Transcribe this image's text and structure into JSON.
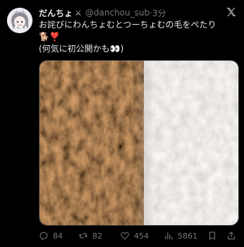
{
  "tweet": {
    "display_name": "だんちょ",
    "name_emoji": "⚔",
    "handle": "@danchou_sub",
    "separator": "·",
    "time": "3分",
    "text_line1": "お詫びにわんちょむとつーちょむの毛をぺたり",
    "text_line2": "🐕❣️",
    "text_line3": "(何気に初公開かも👀)"
  },
  "actions": {
    "replies": "84",
    "retweets": "82",
    "likes": "454",
    "views": "5861"
  },
  "icons": [
    "avatar",
    "crossed-swords-icon",
    "x-logo-icon",
    "reply-icon",
    "retweet-icon",
    "like-icon",
    "views-icon",
    "bookmark-icon",
    "share-icon"
  ],
  "colors": {
    "background": "#000000",
    "text": "#e7e9ea",
    "muted": "#71767b",
    "fur_brown": "#a8784d",
    "fur_white": "#e7e4df"
  }
}
